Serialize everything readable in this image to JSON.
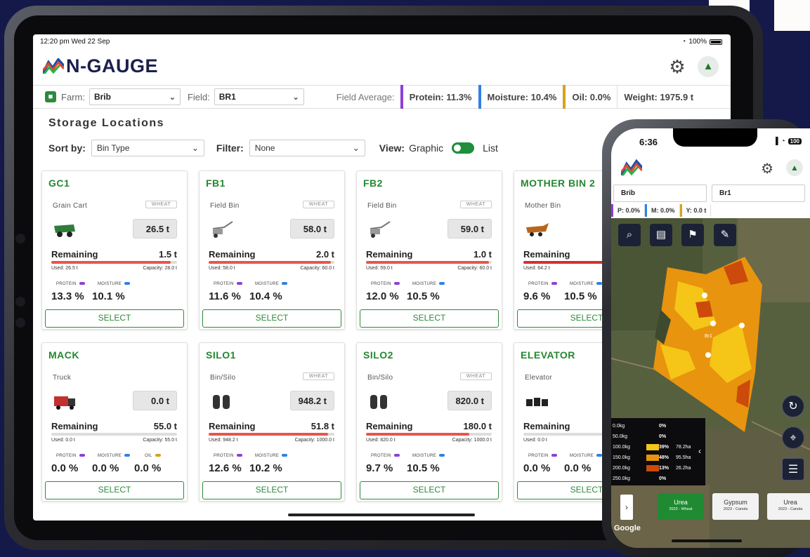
{
  "tablet": {
    "status": {
      "time": "12:20 pm  Wed 22 Sep",
      "battery": "100%"
    },
    "brand": "N-GAUGE",
    "filters": {
      "farm_label": "Farm:",
      "farm_value": "Brib",
      "field_label": "Field:",
      "field_value": "BR1",
      "field_average_label": "Field Average:",
      "protein": "Protein: 11.3%",
      "moisture": "Moisture: 10.4%",
      "oil": "Oil: 0.0%",
      "weight": "Weight: 1975.9 t"
    },
    "colors": {
      "protein": "#8e3fd6",
      "moisture": "#2f80e8",
      "oil": "#d6a21e",
      "brand_green": "#24882f"
    },
    "section_title": "Storage Locations",
    "controls": {
      "sort_label": "Sort by:",
      "sort_value": "Bin Type",
      "filter_label": "Filter:",
      "filter_value": "None",
      "view_label": "View:",
      "view_graphic": "Graphic",
      "view_list": "List"
    },
    "select_label": "SELECT",
    "remaining_label": "Remaining",
    "bins": [
      {
        "name": "GC1",
        "type": "Grain Cart",
        "crop": "WHEAT",
        "icon": "grain-cart-icon",
        "amount": "26.5 t",
        "remaining": "1.5 t",
        "fill_fraction": 0.95,
        "used": "Used: 26.5 t",
        "capacity": "Capacity: 28.0 t",
        "qualities": [
          {
            "label": "PROTEIN",
            "value": "13.3 %",
            "color": "#8e3fd6"
          },
          {
            "label": "MOISTURE",
            "value": "10.1 %",
            "color": "#2f80e8"
          }
        ]
      },
      {
        "name": "FB1",
        "type": "Field Bin",
        "crop": "WHEAT",
        "icon": "field-bin-icon",
        "amount": "58.0 t",
        "remaining": "2.0 t",
        "fill_fraction": 0.97,
        "used": "Used: 58.0 t",
        "capacity": "Capacity: 60.0 t",
        "qualities": [
          {
            "label": "PROTEIN",
            "value": "11.6 %",
            "color": "#8e3fd6"
          },
          {
            "label": "MOISTURE",
            "value": "10.4 %",
            "color": "#2f80e8"
          }
        ]
      },
      {
        "name": "FB2",
        "type": "Field Bin",
        "crop": "WHEAT",
        "icon": "field-bin-icon",
        "amount": "59.0 t",
        "remaining": "1.0 t",
        "fill_fraction": 0.98,
        "used": "Used: 59.0 t",
        "capacity": "Capacity: 60.0 t",
        "qualities": [
          {
            "label": "PROTEIN",
            "value": "12.0 %",
            "color": "#8e3fd6"
          },
          {
            "label": "MOISTURE",
            "value": "10.5 %",
            "color": "#2f80e8"
          }
        ]
      },
      {
        "name": "MOTHER BIN 2",
        "type": "Mother Bin",
        "crop": "",
        "icon": "mother-bin-icon",
        "amount": "",
        "remaining": "",
        "fill_fraction": 1.0,
        "used": "Used: 64.2 t",
        "capacity": "",
        "qualities": [
          {
            "label": "PROTEIN",
            "value": "9.6 %",
            "color": "#8e3fd6"
          },
          {
            "label": "MOISTURE",
            "value": "10.5 %",
            "color": "#2f80e8"
          }
        ]
      },
      {
        "name": "MACK",
        "type": "Truck",
        "crop": "",
        "icon": "truck-icon",
        "amount": "0.0 t",
        "remaining": "55.0 t",
        "fill_fraction": 0.0,
        "used": "Used: 0.0 t",
        "capacity": "Capacity: 55.0 t",
        "qualities": [
          {
            "label": "PROTEIN",
            "value": "0.0 %",
            "color": "#8e3fd6"
          },
          {
            "label": "MOISTURE",
            "value": "0.0 %",
            "color": "#2f80e8"
          },
          {
            "label": "OIL",
            "value": "0.0 %",
            "color": "#d6a21e"
          }
        ]
      },
      {
        "name": "SILO1",
        "type": "Bin/Silo",
        "crop": "WHEAT",
        "icon": "silo-icon",
        "amount": "948.2 t",
        "remaining": "51.8 t",
        "fill_fraction": 0.95,
        "used": "Used: 948.2 t",
        "capacity": "Capacity: 1000.0 t",
        "qualities": [
          {
            "label": "PROTEIN",
            "value": "12.6 %",
            "color": "#8e3fd6"
          },
          {
            "label": "MOISTURE",
            "value": "10.2 %",
            "color": "#2f80e8"
          }
        ]
      },
      {
        "name": "SILO2",
        "type": "Bin/Silo",
        "crop": "WHEAT",
        "icon": "silo-icon",
        "amount": "820.0 t",
        "remaining": "180.0 t",
        "fill_fraction": 0.82,
        "used": "Used: 820.0 t",
        "capacity": "Capacity: 1000.0 t",
        "qualities": [
          {
            "label": "PROTEIN",
            "value": "9.7 %",
            "color": "#8e3fd6"
          },
          {
            "label": "MOISTURE",
            "value": "10.5 %",
            "color": "#2f80e8"
          }
        ]
      },
      {
        "name": "ELEVATOR",
        "type": "Elevator",
        "crop": "",
        "icon": "elevator-icon",
        "amount": "",
        "remaining": "",
        "fill_fraction": 0.0,
        "used": "Used: 0.0 t",
        "capacity": "Ca",
        "qualities": [
          {
            "label": "PROTEIN",
            "value": "0.0 %",
            "color": "#8e3fd6"
          },
          {
            "label": "MOISTURE",
            "value": "0.0 %",
            "color": "#2f80e8"
          }
        ]
      }
    ]
  },
  "phone": {
    "time": "6:36",
    "battery": "100",
    "farm": "Brib",
    "field": "Br1",
    "metrics": [
      {
        "text": "P: 0.0%",
        "color": "#8e3fd6"
      },
      {
        "text": "M: 0.0%",
        "color": "#2f80e8"
      },
      {
        "text": "Y: 0.0 t",
        "color": "#d6a21e"
      }
    ],
    "map_label": "Br1",
    "legend": [
      {
        "rate": "0.0kg",
        "pct": "0%",
        "ha": "",
        "color": ""
      },
      {
        "rate": "50.0kg",
        "pct": "0%",
        "ha": "",
        "color": ""
      },
      {
        "rate": "100.0kg",
        "pct": "39%",
        "ha": "78.2ha",
        "color": "#f5c518"
      },
      {
        "rate": "150.0kg",
        "pct": "48%",
        "ha": "95.5ha",
        "color": "#e8940e"
      },
      {
        "rate": "200.0kg",
        "pct": "13%",
        "ha": "26.2ha",
        "color": "#cc4a0c"
      },
      {
        "rate": "250.0kg",
        "pct": "0%",
        "ha": "",
        "color": ""
      }
    ],
    "products": [
      {
        "name": "Urea",
        "sub": "2023 - Wheat",
        "active": true
      },
      {
        "name": "Gypsum",
        "sub": "2023 - Canola",
        "active": false
      },
      {
        "name": "Urea",
        "sub": "2023 - Canola",
        "active": false
      }
    ],
    "attribution": "Google"
  }
}
